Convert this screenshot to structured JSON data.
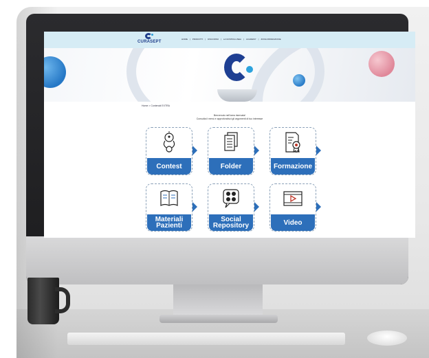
{
  "site": {
    "logo_text": "CURASEPT",
    "menu": [
      "HOME",
      "PRODOTTI",
      "DISCORSO",
      "LA NOSTRA LINEA",
      "ACADEMY",
      "ZONA RIPARAZIONE"
    ],
    "breadcrumb": "Home > Contenuti EXTRA",
    "welcome_line1": "Benvenuto nell'area riservata!",
    "welcome_line2": "Consulta il menù e approfondisci gli argomenti di tuo interesse"
  },
  "cards": [
    {
      "label": "Contest",
      "icon": "trophy-icon"
    },
    {
      "label": "Folder",
      "icon": "documents-icon"
    },
    {
      "label": "Formazione",
      "icon": "certificate-icon"
    },
    {
      "label": "Materiali Pazienti",
      "icon": "book-icon"
    },
    {
      "label": "Social Repository",
      "icon": "social-chat-icon"
    },
    {
      "label": "Video",
      "icon": "video-icon"
    }
  ],
  "colors": {
    "brand_blue": "#2d6fba",
    "nav_bg": "#d6ecf5",
    "logo_blue": "#1f3d8a"
  }
}
